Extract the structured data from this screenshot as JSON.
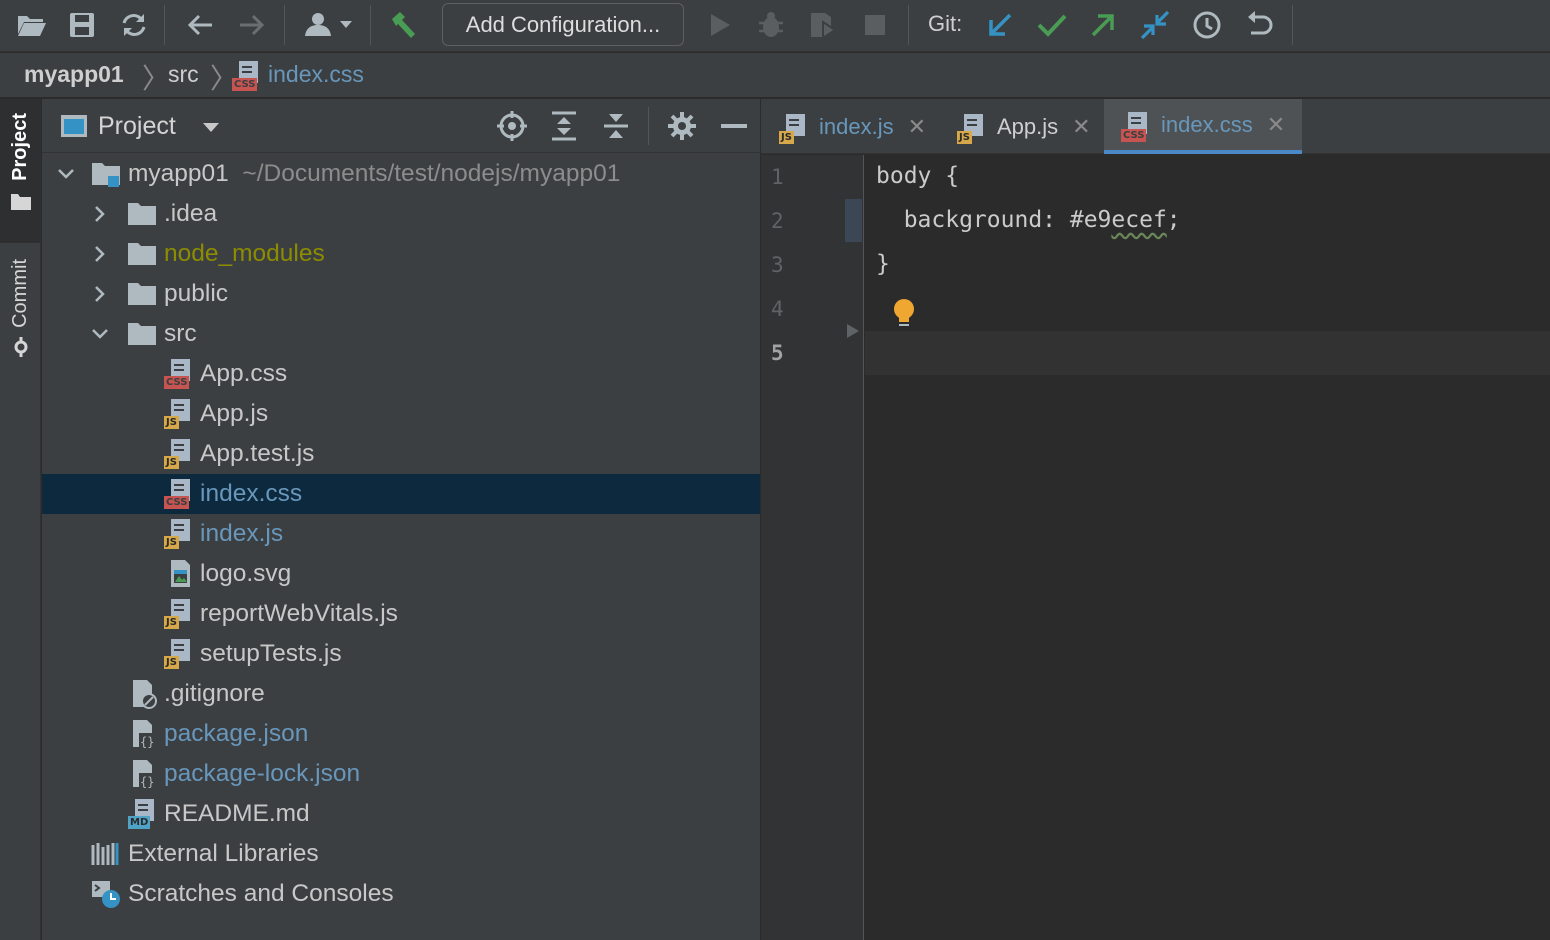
{
  "toolbar": {
    "icons": [
      "open-folder-icon",
      "save-icon",
      "sync-icon",
      "back-icon",
      "forward-icon",
      "user-dropdown-icon",
      "build-hammer-icon",
      "run-icon",
      "debug-icon",
      "coverage-icon",
      "stop-icon",
      "git-update-icon",
      "git-commit-icon",
      "git-push-icon",
      "git-compare-icon",
      "history-icon",
      "rollback-icon"
    ],
    "add_config_label": "Add Configuration...",
    "git_label": "Git:"
  },
  "breadcrumb": {
    "items": [
      "myapp01",
      "src",
      "index.css"
    ]
  },
  "leftstrip": {
    "project_label": "Project",
    "commit_label": "Commit"
  },
  "project_panel": {
    "title": "Project",
    "header_icons": [
      "locate-icon",
      "expand-all-icon",
      "collapse-all-icon",
      "settings-icon",
      "hide-icon"
    ]
  },
  "tree": {
    "root": {
      "name": "myapp01",
      "path": "~/Documents/test/nodejs/myapp01"
    },
    "items": [
      {
        "name": ".idea",
        "kind": "folder"
      },
      {
        "name": "node_modules",
        "kind": "folder"
      },
      {
        "name": "public",
        "kind": "folder"
      },
      {
        "name": "src",
        "kind": "folder"
      },
      {
        "name": "App.css",
        "kind": "css"
      },
      {
        "name": "App.js",
        "kind": "js"
      },
      {
        "name": "App.test.js",
        "kind": "js"
      },
      {
        "name": "index.css",
        "kind": "css"
      },
      {
        "name": "index.js",
        "kind": "js"
      },
      {
        "name": "logo.svg",
        "kind": "svg"
      },
      {
        "name": "reportWebVitals.js",
        "kind": "js"
      },
      {
        "name": "setupTests.js",
        "kind": "js"
      },
      {
        "name": ".gitignore",
        "kind": "ignore"
      },
      {
        "name": "package.json",
        "kind": "json"
      },
      {
        "name": "package-lock.json",
        "kind": "json"
      },
      {
        "name": "README.md",
        "kind": "md"
      },
      {
        "name": "External Libraries",
        "kind": "libraries"
      },
      {
        "name": "Scratches and Consoles",
        "kind": "scratches"
      }
    ]
  },
  "editor": {
    "tabs": [
      {
        "name": "index.js",
        "badge": "JS"
      },
      {
        "name": "App.js",
        "badge": "JS"
      },
      {
        "name": "index.css",
        "badge": "CSS"
      }
    ],
    "active_tab": "index.css",
    "lines": [
      "1",
      "2",
      "3",
      "4",
      "5"
    ],
    "code": {
      "l1": "body {",
      "l2_prop": "  background: #e9",
      "l2_squig": "ecef",
      "l2_end": ";",
      "l3": "}"
    }
  },
  "colors": {
    "background": "#2b2b2b",
    "panel": "#3c3f41",
    "selection": "#0d293e",
    "link_text": "#6897bb",
    "ignored_text": "#8c8c00",
    "active_tab_underline": "#4a88c7",
    "git_update": "#3592c4",
    "git_commit": "#499c54",
    "bulb": "#f0a732"
  }
}
